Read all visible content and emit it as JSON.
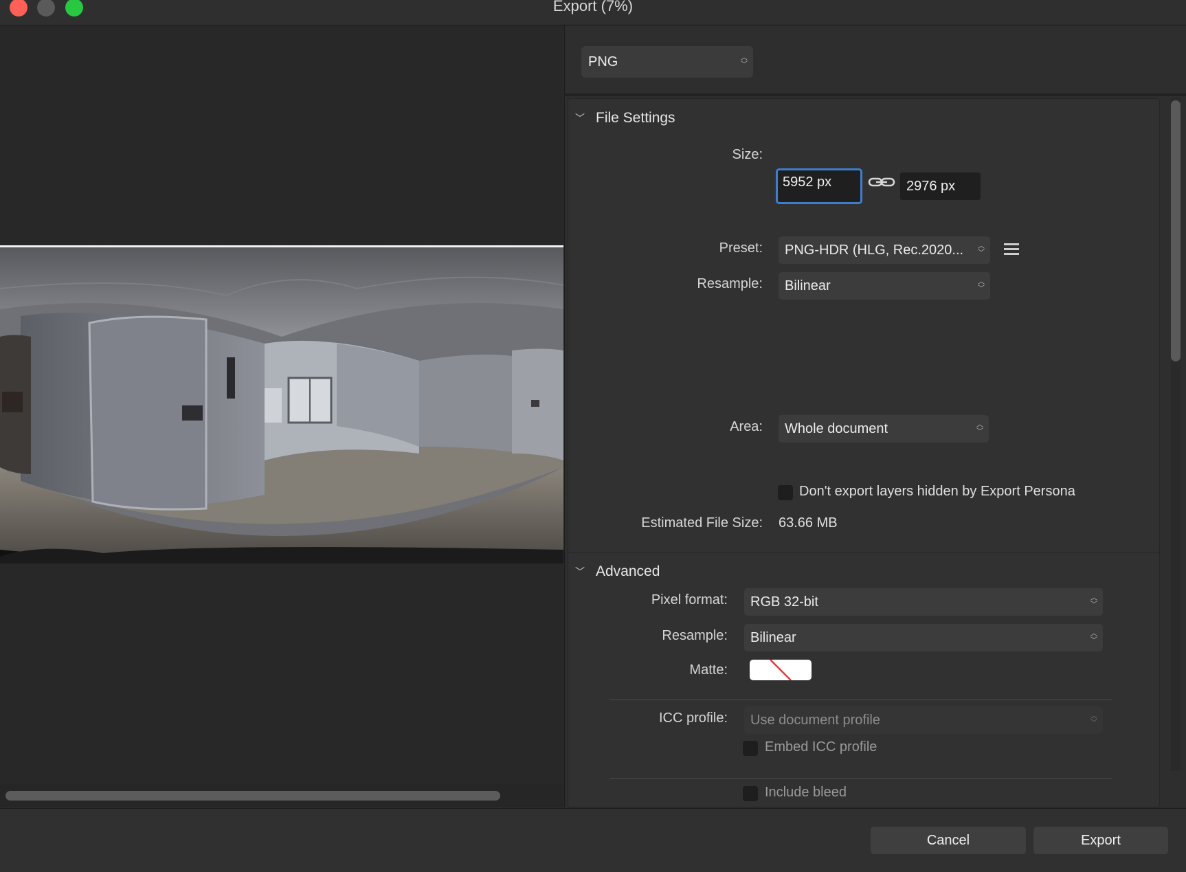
{
  "window": {
    "title": "Export (7%)"
  },
  "format": {
    "selected": "PNG"
  },
  "file_settings": {
    "header": "File Settings",
    "size_label": "Size:",
    "width_value": "5952 px",
    "height_value": "2976 px",
    "preset_label": "Preset:",
    "preset_value": "PNG-HDR (HLG, Rec.2020...",
    "resample_label": "Resample:",
    "resample_value": "Bilinear",
    "area_label": "Area:",
    "area_value": "Whole document",
    "hidden_layers_label": "Don't export layers hidden by Export Persona",
    "hidden_layers_checked": false,
    "est_size_label": "Estimated File Size:",
    "est_size_value": "63.66 MB"
  },
  "advanced": {
    "header": "Advanced",
    "pixel_format_label": "Pixel format:",
    "pixel_format_value": "RGB 32-bit",
    "resample_label": "Resample:",
    "resample_value": "Bilinear",
    "matte_label": "Matte:",
    "icc_label": "ICC profile:",
    "icc_value": "Use document profile",
    "embed_icc_label": "Embed ICC profile",
    "embed_icc_checked": false,
    "include_bleed_label": "Include bleed",
    "include_bleed_checked": false
  },
  "footer": {
    "cancel_label": "Cancel",
    "export_label": "Export"
  },
  "colors": {
    "focus_ring": "#3d7fcf",
    "close": "#fe5f57",
    "zoom": "#28c840"
  }
}
